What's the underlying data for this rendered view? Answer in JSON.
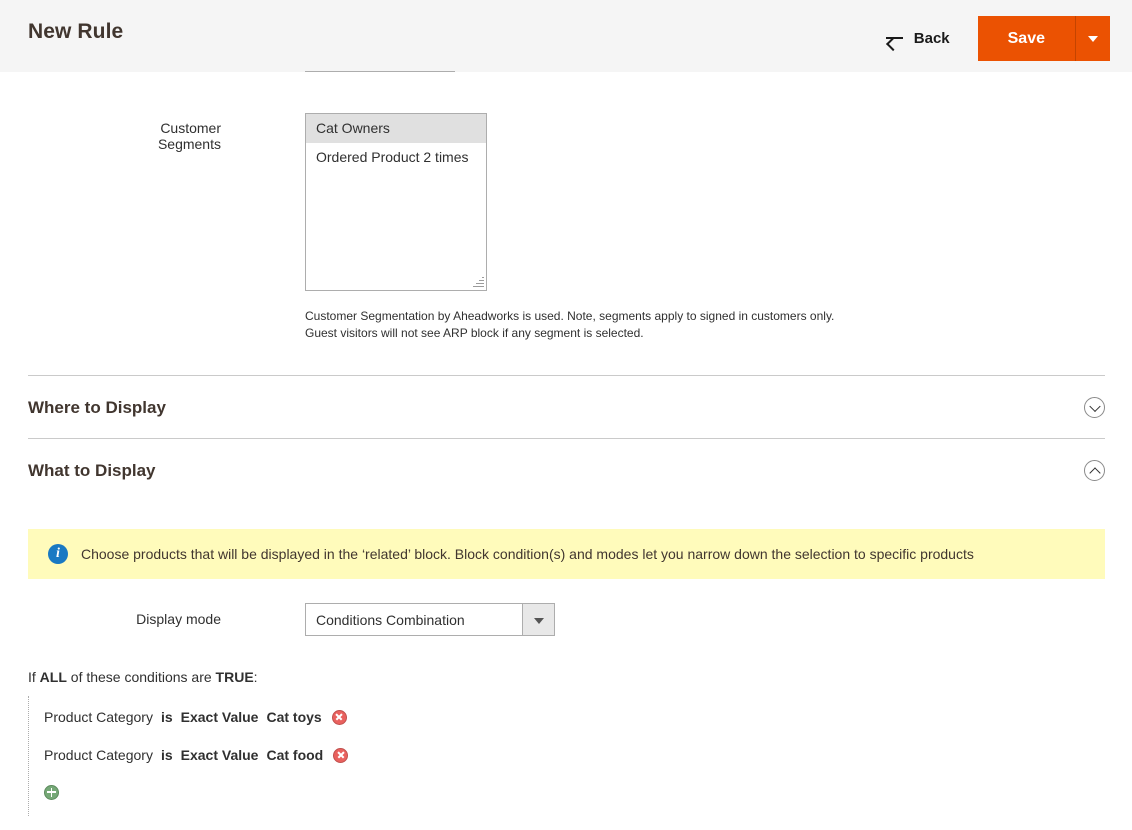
{
  "header": {
    "title": "New Rule",
    "back_label": "Back",
    "save_label": "Save",
    "save_split_icon": "caret-down-icon",
    "back_icon": "arrow-left-icon",
    "accent_color": "#eb5202",
    "background_color": "#f5f5f5"
  },
  "customer_segments": {
    "label": "Customer Segments",
    "options": [
      {
        "label": "Cat Owners",
        "selected": true
      },
      {
        "label": "Ordered Product 2 times",
        "selected": false
      }
    ],
    "note": "Customer Segmentation by Aheadworks is used. Note, segments apply to signed in customers only. Guest visitors will not see ARP block if any segment is selected."
  },
  "sections": [
    {
      "title": "Where to Display",
      "expanded": false,
      "icon": "chevron-down-circle-icon"
    },
    {
      "title": "What to Display",
      "expanded": true,
      "icon": "chevron-up-circle-icon"
    }
  ],
  "info_message": {
    "icon": "info-circle-icon",
    "text": "Choose products that will be displayed in the ‘related’ block. Block condition(s) and modes let you narrow down the selection to specific products",
    "background_color": "#fffbbb",
    "icon_color": "#1979c3"
  },
  "display_mode": {
    "label": "Display mode",
    "value": "Conditions Combination",
    "arrow_icon": "caret-down-icon"
  },
  "conditions": {
    "intro": {
      "if_text": "If",
      "aggregator": "ALL",
      "middle_text": "of these conditions are",
      "value": "TRUE",
      "colon": ":"
    },
    "rows": [
      {
        "attribute": "Product Category",
        "operator": "is",
        "value_type": "Exact Value",
        "value": "Cat toys",
        "remove_icon": "remove-circle-icon"
      },
      {
        "attribute": "Product Category",
        "operator": "is",
        "value_type": "Exact Value",
        "value": "Cat food",
        "remove_icon": "remove-circle-icon"
      }
    ],
    "add_icon": "add-circle-icon"
  }
}
